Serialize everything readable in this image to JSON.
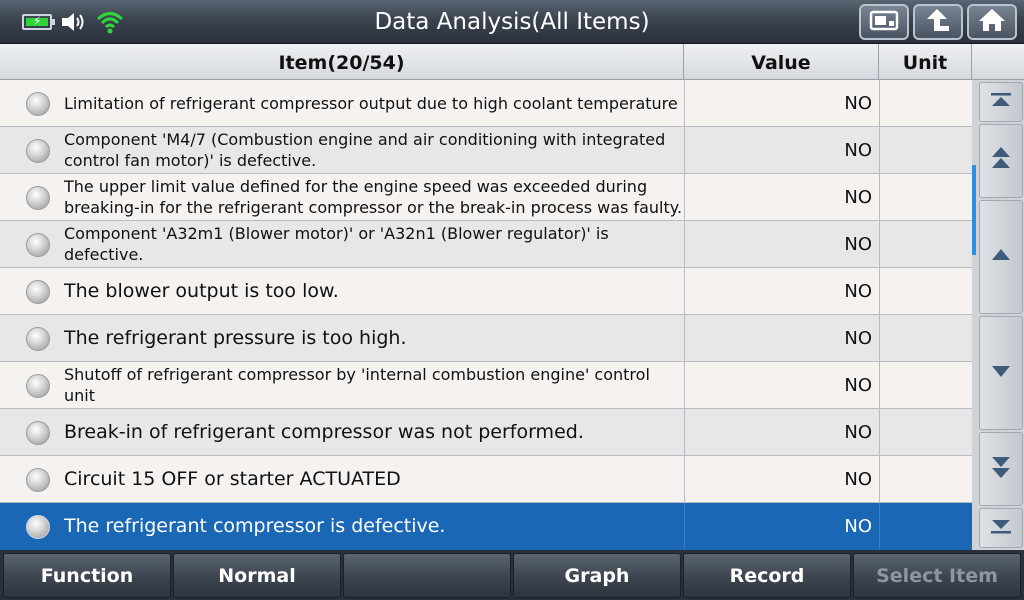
{
  "title": "Data Analysis(All Items)",
  "header": {
    "item": "Item(20/54)",
    "value": "Value",
    "unit": "Unit"
  },
  "status": {
    "battery_icon": "battery-charging-icon",
    "volume_icon": "speaker-icon",
    "wifi_icon": "wifi-icon"
  },
  "toolbar_icons": [
    "screenshot-icon",
    "back-arrow-icon",
    "home-icon"
  ],
  "rows": [
    {
      "item": "Limitation of refrigerant compressor output due to high coolant temperature",
      "value": "NO",
      "unit": ""
    },
    {
      "item": "Component 'M4/7 (Combustion engine and air conditioning with integrated control fan motor)' is defective.",
      "value": "NO",
      "unit": ""
    },
    {
      "item": "The upper limit value defined for the engine speed was exceeded during breaking-in for the refrigerant compressor or the break-in process was faulty.",
      "value": "NO",
      "unit": ""
    },
    {
      "item": "Component 'A32m1 (Blower motor)' or 'A32n1 (Blower regulator)' is defective.",
      "value": "NO",
      "unit": ""
    },
    {
      "item": "The blower output is too low.",
      "value": "NO",
      "unit": ""
    },
    {
      "item": "The refrigerant pressure is too high.",
      "value": "NO",
      "unit": ""
    },
    {
      "item": "Shutoff of refrigerant compressor by 'internal combustion engine' control unit",
      "value": "NO",
      "unit": ""
    },
    {
      "item": "Break-in of refrigerant compressor was not performed.",
      "value": "NO",
      "unit": ""
    },
    {
      "item": "Circuit 15 OFF or starter ACTUATED",
      "value": "NO",
      "unit": ""
    },
    {
      "item": "The refrigerant compressor is defective.",
      "value": "NO",
      "unit": ""
    }
  ],
  "selected_row": 9,
  "bottom": {
    "function": "Function",
    "normal": "Normal",
    "empty": "",
    "graph": "Graph",
    "record": "Record",
    "select_item": "Select Item"
  },
  "colors": {
    "selected_row": "#1a67b5",
    "battery": "#2fd43a",
    "wifi": "#2fd43a",
    "scroll_indicator": "#2d8fe0"
  }
}
